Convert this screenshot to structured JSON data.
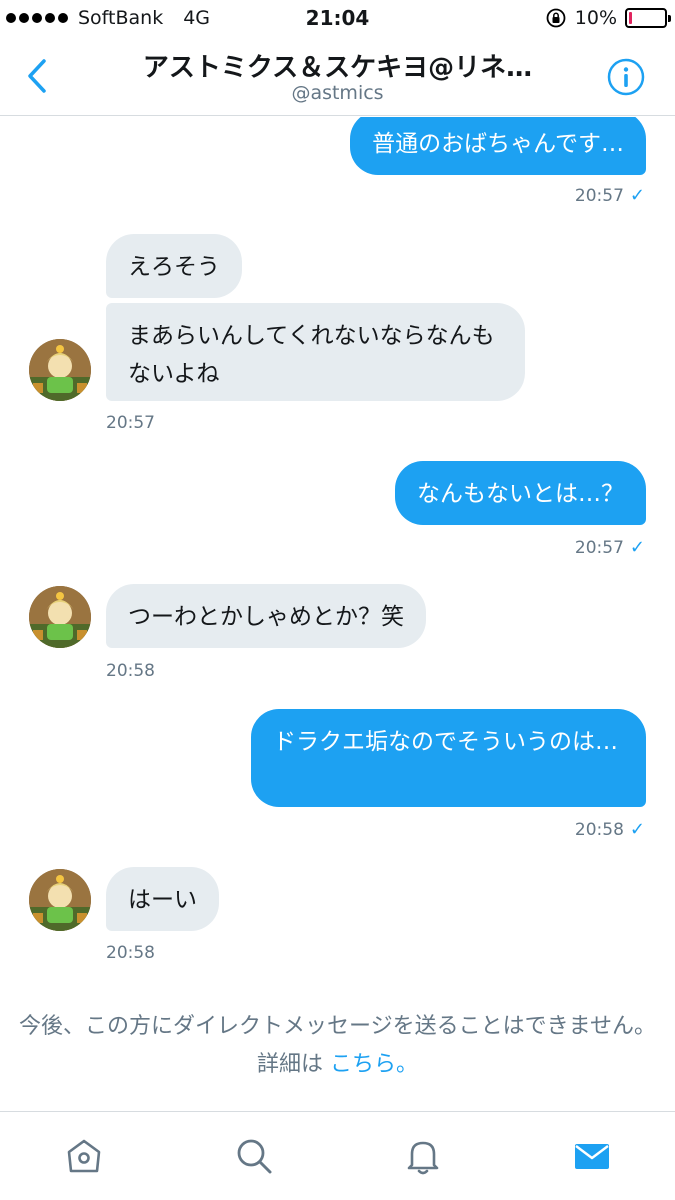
{
  "status_bar": {
    "carrier": "SoftBank",
    "network": "4G",
    "time": "21:04",
    "battery": "10%",
    "battery_level": 0.1
  },
  "header": {
    "title": "アストミクス＆スケキヨ@リネ…",
    "handle": "@astmics"
  },
  "messages": [
    {
      "from": "me",
      "text": "普通のおばちゃんです…",
      "time": "20:57",
      "read": true
    },
    {
      "from": "them",
      "texts": [
        "えろそう",
        "まあらいんしてくれないならなんもないよね"
      ],
      "time": "20:57"
    },
    {
      "from": "me",
      "text": "なんもないとは…？",
      "time": "20:57",
      "read": true
    },
    {
      "from": "them",
      "texts": [
        "つーわとかしゃめとか？笑"
      ],
      "time": "20:58"
    },
    {
      "from": "me",
      "text": "ドラクエ垢なのでそういうのは…",
      "time": "20:58",
      "read": true
    },
    {
      "from": "them",
      "texts": [
        "はーい"
      ],
      "time": "20:58"
    }
  ],
  "notice": {
    "text": "今後、この方にダイレクトメッセージを送ることはできません。詳細は ",
    "link": "こちら。"
  },
  "tabs": [
    "home-icon",
    "search-icon",
    "notifications-icon",
    "messages-icon"
  ],
  "colors": {
    "accent": "#1da1f2",
    "received_bubble": "#e6ecf0",
    "muted_text": "#657786"
  }
}
